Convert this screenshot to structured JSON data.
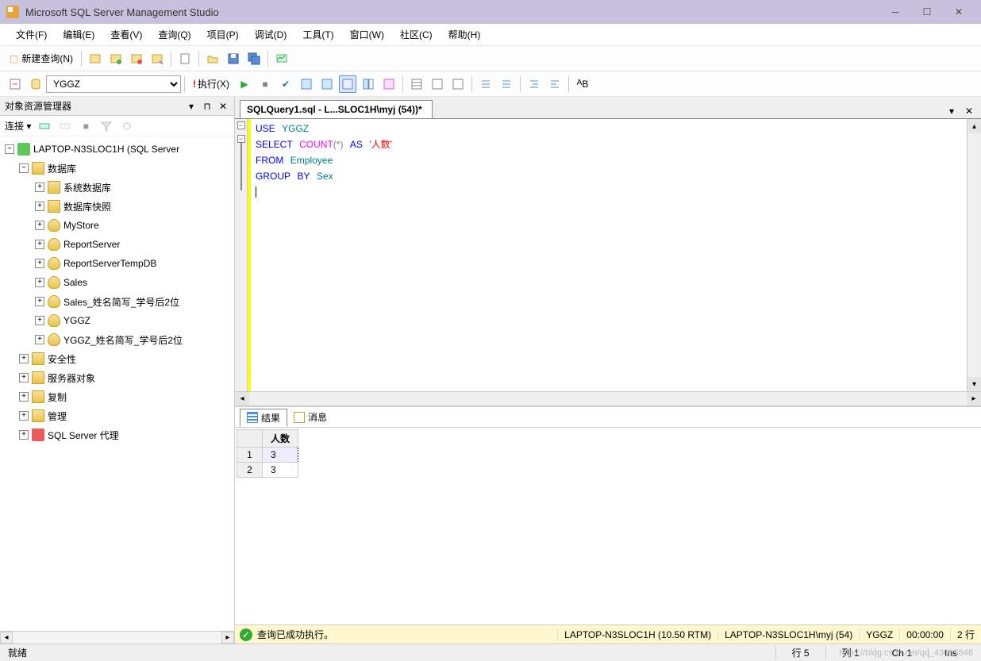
{
  "titlebar": {
    "title": "Microsoft SQL Server Management Studio"
  },
  "menu": {
    "items": [
      "文件(F)",
      "编辑(E)",
      "查看(V)",
      "查询(Q)",
      "项目(P)",
      "调试(D)",
      "工具(T)",
      "窗口(W)",
      "社区(C)",
      "帮助(H)"
    ]
  },
  "toolbar1": {
    "newQuery": "新建查询(N)"
  },
  "toolbar2": {
    "databaseSelected": "YGGZ",
    "execute": "执行(X)"
  },
  "explorer": {
    "title": "对象资源管理器",
    "connectLabel": "连接 ▾",
    "server": "LAPTOP-N3SLOC1H (SQL Server",
    "databasesFolder": "数据库",
    "systemDb": "系统数据库",
    "dbSnapshot": "数据库快照",
    "dbs": [
      "MyStore",
      "ReportServer",
      "ReportServerTempDB",
      "Sales",
      "Sales_姓名简写_学号后2位",
      "YGGZ",
      "YGGZ_姓名简写_学号后2位"
    ],
    "security": "安全性",
    "serverObjects": "服务器对象",
    "replication": "复制",
    "management": "管理",
    "agent": "SQL Server 代理"
  },
  "tab": {
    "label": "SQLQuery1.sql - L...SLOC1H\\myj (54))*"
  },
  "sql": {
    "l1": {
      "a": "USE",
      "b": "YGGZ"
    },
    "l2": {
      "a": "SELECT",
      "b": "COUNT",
      "c": "(",
      "d": "*",
      "e": ")",
      "f": "AS",
      "g": "'人数'"
    },
    "l3": {
      "a": "FROM",
      "b": "Employee"
    },
    "l4": {
      "a": "GROUP",
      "b": "BY",
      "c": "Sex"
    }
  },
  "results": {
    "tabResults": "结果",
    "tabMessages": "消息",
    "header": "人数",
    "rows": [
      {
        "n": "1",
        "v": "3"
      },
      {
        "n": "2",
        "v": "3"
      }
    ]
  },
  "queryStatus": {
    "msg": "查询已成功执行。",
    "server": "LAPTOP-N3SLOC1H (10.50 RTM)",
    "user": "LAPTOP-N3SLOC1H\\myj (54)",
    "db": "YGGZ",
    "time": "00:00:00",
    "rows": "2 行"
  },
  "appStatus": {
    "ready": "就绪",
    "line": "行 5",
    "col": "列 1",
    "ch": "Ch 1",
    "ins": "Ins"
  },
  "watermark": "https://blog.csdn.net/qq_43085848"
}
